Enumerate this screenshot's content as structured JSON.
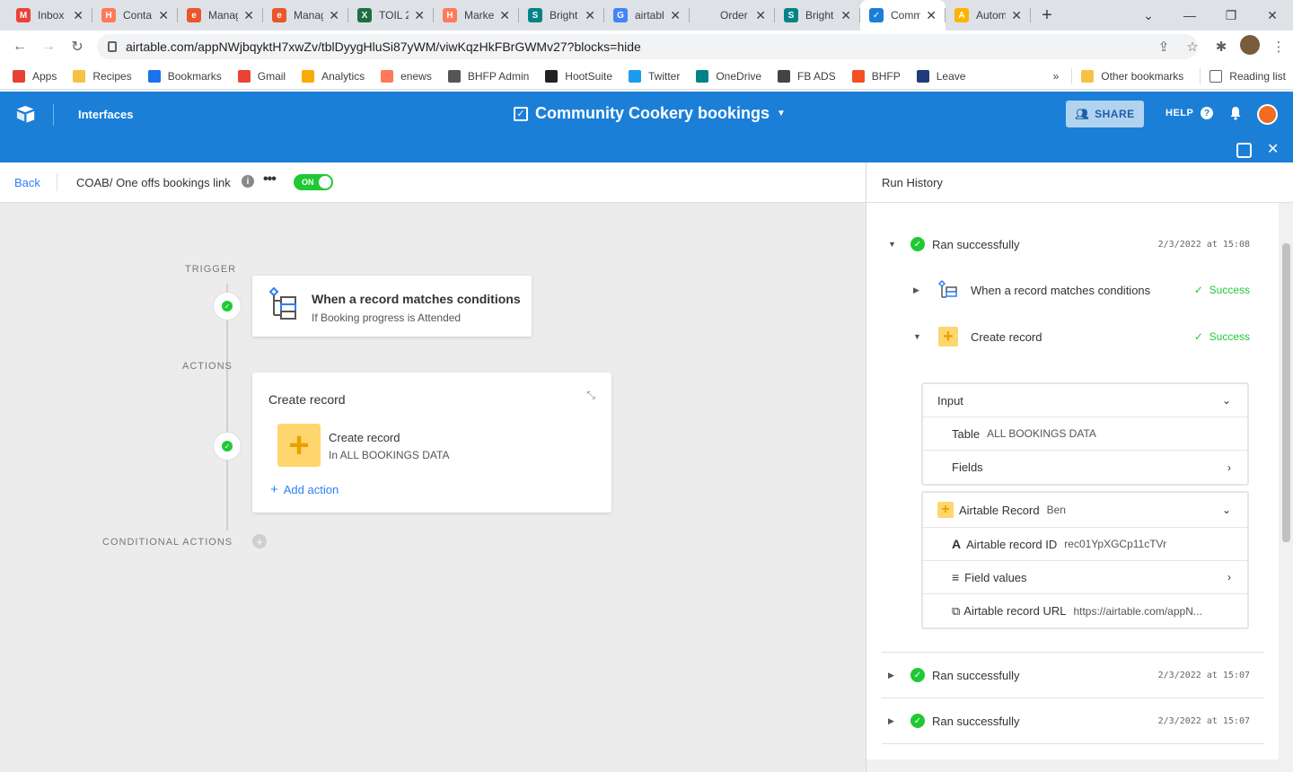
{
  "browser": {
    "tabs": [
      {
        "title": "Inbox",
        "icon": "gmail-icon",
        "color": "#ea4335",
        "letter": "M"
      },
      {
        "title": "Conta",
        "icon": "hubspot-icon",
        "color": "#ff7a59",
        "letter": "H"
      },
      {
        "title": "Manag",
        "icon": "edge-e-icon",
        "color": "#e8582a",
        "letter": "e"
      },
      {
        "title": "Manag",
        "icon": "edge-e-icon",
        "color": "#e8582a",
        "letter": "e"
      },
      {
        "title": "TOIL 2",
        "icon": "excel-icon",
        "color": "#1d6f42",
        "letter": "X"
      },
      {
        "title": "Marke",
        "icon": "hubspot-icon",
        "color": "#ff7a59",
        "letter": "H"
      },
      {
        "title": "Bright",
        "icon": "sharepoint-icon",
        "color": "#038387",
        "letter": "S"
      },
      {
        "title": "airtabl",
        "icon": "google-icon",
        "color": "#4285f4",
        "letter": "G"
      },
      {
        "title": "Order",
        "icon": "blank-icon",
        "color": "#dee1e6",
        "letter": ""
      },
      {
        "title": "Bright",
        "icon": "sharepoint-icon",
        "color": "#038387",
        "letter": "S"
      },
      {
        "title": "Comm",
        "icon": "checkbox-icon",
        "color": "#1b7fd8",
        "letter": "✓"
      },
      {
        "title": "Autom",
        "icon": "airtable-icon",
        "color": "#fcb400",
        "letter": "A"
      }
    ],
    "url": "airtable.com/appNWjbqyktH7xwZv/tblDyygHluSi87yWM/viwKqzHkFBrGWMv27?blocks=hide",
    "bookmarks": [
      {
        "label": "Apps",
        "icon": "apps-grid-icon",
        "color": "#e94235"
      },
      {
        "label": "Recipes",
        "icon": "folder-icon",
        "color": "#f6c244"
      },
      {
        "label": "Bookmarks",
        "icon": "star-icon",
        "color": "#1a73e8"
      },
      {
        "label": "Gmail",
        "icon": "gmail-icon",
        "color": "#ea4335"
      },
      {
        "label": "Analytics",
        "icon": "analytics-icon",
        "color": "#f9ab00"
      },
      {
        "label": "enews",
        "icon": "hubspot-icon",
        "color": "#ff7a59"
      },
      {
        "label": "BHFP Admin",
        "icon": "globe-icon",
        "color": "#555555"
      },
      {
        "label": "HootSuite",
        "icon": "hootsuite-icon",
        "color": "#222222"
      },
      {
        "label": "Twitter",
        "icon": "twitter-icon",
        "color": "#1d9bf0"
      },
      {
        "label": "OneDrive",
        "icon": "sharepoint-icon",
        "color": "#038387"
      },
      {
        "label": "FB ADS",
        "icon": "fb-ads-icon",
        "color": "#444444"
      },
      {
        "label": "BHFP",
        "icon": "microsoft-icon",
        "color": "#f25022"
      },
      {
        "label": "Leave",
        "icon": "leave-icon",
        "color": "#1f3b7a"
      }
    ],
    "bookmarks_right": [
      {
        "label": "Other bookmarks",
        "icon": "folder-icon"
      },
      {
        "label": "Reading list",
        "icon": "reading-list-icon"
      }
    ]
  },
  "header": {
    "interfaces_label": "Interfaces",
    "base_title": "Community Cookery bookings",
    "share_label": "SHARE",
    "help_label": "HELP"
  },
  "editor": {
    "back_label": "Back",
    "automation_name": "COAB/ One offs bookings link",
    "toggle_label": "ON",
    "trigger_section": "TRIGGER",
    "actions_section": "ACTIONS",
    "conditional_section": "CONDITIONAL ACTIONS",
    "trigger": {
      "title": "When a record matches conditions",
      "subtitle": "If Booking progress is Attended"
    },
    "action": {
      "header": "Create record",
      "title": "Create record",
      "subtitle": "In ALL BOOKINGS DATA",
      "add_action_label": "Add action"
    }
  },
  "history": {
    "title": "Run History",
    "runs": [
      {
        "label": "Ran successfully",
        "time": "2/3/2022 at 15:08",
        "expanded": true
      },
      {
        "label": "Ran successfully",
        "time": "2/3/2022 at 15:07",
        "expanded": false
      },
      {
        "label": "Ran successfully",
        "time": "2/3/2022 at 15:07",
        "expanded": false
      }
    ],
    "steps": [
      {
        "label": "When a record matches conditions",
        "status": "Success"
      },
      {
        "label": "Create record",
        "status": "Success"
      }
    ],
    "input": {
      "title": "Input",
      "table_label": "Table",
      "table_value": "ALL BOOKINGS DATA",
      "fields_label": "Fields"
    },
    "output": {
      "record_label": "Airtable Record",
      "record_value": "Ben",
      "id_label": "Airtable record ID",
      "id_value": "rec01YpXGCp11cTVr",
      "field_values_label": "Field values",
      "url_label": "Airtable record URL",
      "url_value": "https://airtable.com/appN..."
    }
  },
  "colors": {
    "header_blue": "#1b7fd8",
    "success_green": "#20c933",
    "link_blue": "#2d7ff9",
    "action_yellow": "#ffd66e"
  }
}
